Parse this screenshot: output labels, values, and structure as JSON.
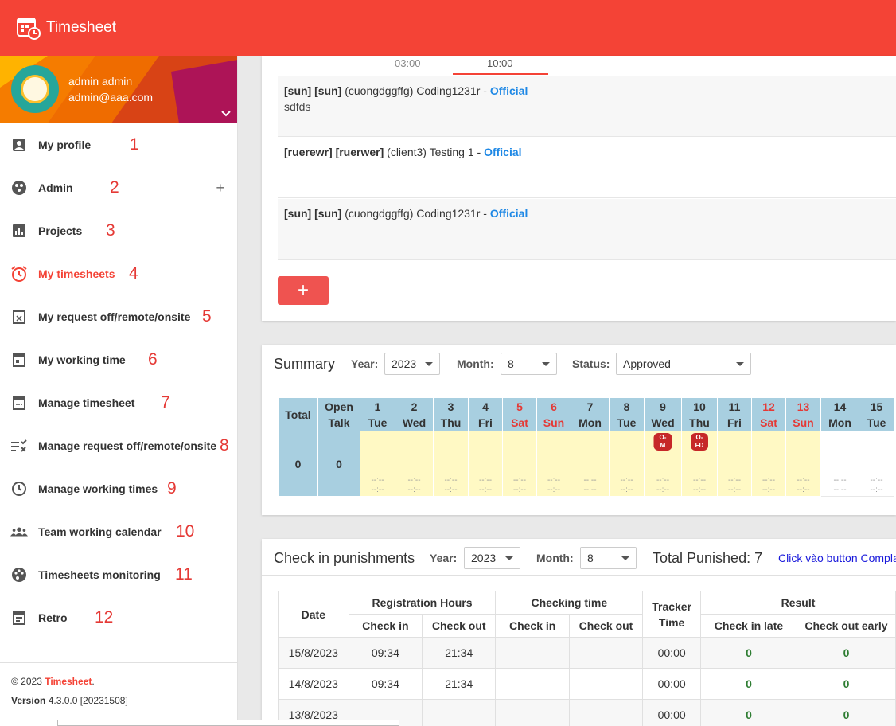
{
  "app": {
    "title": "Timesheet"
  },
  "user": {
    "name": "admin admin",
    "email": "admin@aaa.com"
  },
  "sidebar": {
    "items": [
      {
        "label": "My profile",
        "num": "1",
        "icon": "account-box-icon"
      },
      {
        "label": "Admin",
        "num": "2",
        "icon": "admin-icon",
        "expand": "+"
      },
      {
        "label": "Projects",
        "num": "3",
        "icon": "chart-icon"
      },
      {
        "label": "My timesheets",
        "num": "4",
        "icon": "alarm-icon",
        "active": true
      },
      {
        "label": "My request off/remote/onsite",
        "num": "5",
        "icon": "calendar-x-icon"
      },
      {
        "label": "My working time",
        "num": "6",
        "icon": "calendar-day-icon"
      },
      {
        "label": "Manage timesheet",
        "num": "7",
        "icon": "calendar-dots-icon"
      },
      {
        "label": "Manage request off/remote/onsite",
        "num": "8",
        "icon": "list-x-icon"
      },
      {
        "label": "Manage working times",
        "num": "9",
        "icon": "clock-icon"
      },
      {
        "label": "Team working calendar",
        "num": "10",
        "icon": "team-icon"
      },
      {
        "label": "Timesheets monitoring",
        "num": "11",
        "icon": "palette-icon"
      },
      {
        "label": "Retro",
        "num": "12",
        "icon": "document-icon"
      }
    ],
    "footer": {
      "copyright": "© 2023 ",
      "brand": "Timesheet",
      "period": ".",
      "version_label": "Version",
      "version": " 4.3.0.0 [20231508]"
    }
  },
  "timesheet": {
    "times": [
      "03:00",
      "10:00"
    ],
    "entries": [
      {
        "tags": "[sun] [sun]",
        "desc": " (cuongdggffg) Coding1231r - ",
        "type": "Official",
        "note": "sdfds"
      },
      {
        "tags": "[ruerewr] [ruerwer]",
        "desc": " (client3) Testing 1 - ",
        "type": "Official",
        "note": ""
      },
      {
        "tags": "[sun] [sun]",
        "desc": " (cuongdggffg) Coding1231r - ",
        "type": "Official",
        "note": ""
      }
    ],
    "add_label": "+"
  },
  "summary": {
    "title": "Summary",
    "year_label": "Year:",
    "year": "2023",
    "month_label": "Month:",
    "month": "8",
    "status_label": "Status:",
    "status": "Approved",
    "total_header": "Total",
    "open_talk_header": "Open Talk",
    "total": "0",
    "open_talk": "0",
    "days": [
      {
        "d": "1",
        "w": "Tue"
      },
      {
        "d": "2",
        "w": "Wed"
      },
      {
        "d": "3",
        "w": "Thu"
      },
      {
        "d": "4",
        "w": "Fri"
      },
      {
        "d": "5",
        "w": "Sat",
        "weekend": true
      },
      {
        "d": "6",
        "w": "Sun",
        "weekend": true
      },
      {
        "d": "7",
        "w": "Mon"
      },
      {
        "d": "8",
        "w": "Tue"
      },
      {
        "d": "9",
        "w": "Wed",
        "badge": "O-M"
      },
      {
        "d": "10",
        "w": "Thu",
        "badge": "O-FD"
      },
      {
        "d": "11",
        "w": "Fri"
      },
      {
        "d": "12",
        "w": "Sat",
        "weekend": true
      },
      {
        "d": "13",
        "w": "Sun",
        "weekend": true
      },
      {
        "d": "14",
        "w": "Mon",
        "blank": true
      },
      {
        "d": "15",
        "w": "Tue",
        "blank": true
      }
    ],
    "empty_time": "--:--"
  },
  "punishments": {
    "title": "Check in punishments",
    "year_label": "Year:",
    "year": "2023",
    "month_label": "Month:",
    "month": "8",
    "total_label": "Total Punished: 7",
    "link_text": "Click vào button Compla",
    "headers": {
      "date": "Date",
      "registration": "Registration Hours",
      "checking": "Checking time",
      "tracker": "Tracker Time",
      "result": "Result",
      "check_in": "Check in",
      "check_out": "Check out",
      "check_in_late": "Check in late",
      "check_out_early": "Check out early"
    },
    "rows": [
      {
        "date": "15/8/2023",
        "reg_in": "09:34",
        "reg_out": "21:34",
        "chk_in": "",
        "chk_out": "",
        "tracker": "00:00",
        "late": "0",
        "early": "0"
      },
      {
        "date": "14/8/2023",
        "reg_in": "09:34",
        "reg_out": "21:34",
        "chk_in": "",
        "chk_out": "",
        "tracker": "00:00",
        "late": "0",
        "early": "0"
      },
      {
        "date": "13/8/2023",
        "reg_in": "",
        "reg_out": "",
        "chk_in": "",
        "chk_out": "",
        "tracker": "00:00",
        "late": "0",
        "early": "0"
      }
    ]
  },
  "colors": {
    "primary": "#f44336",
    "header_blue": "#a8cfe0",
    "day_yellow": "#fff9c4",
    "link": "#1e88e5"
  }
}
